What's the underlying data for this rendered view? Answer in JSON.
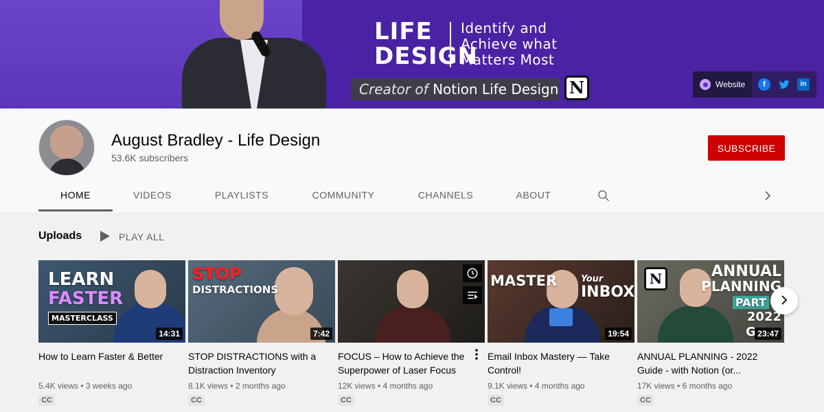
{
  "banner": {
    "title_line1": "LIFE",
    "title_line2": "DESIGN",
    "tagline_line1": "Identify and",
    "tagline_line2": "Achieve what",
    "tagline_line3": "Matters Most",
    "creator_prefix": "Creator",
    "creator_of": "of",
    "creator_suffix": "Notion Life Design",
    "notion_logo": "N",
    "links": {
      "website_label": "Website",
      "social_icons": [
        "facebook-icon",
        "twitter-icon",
        "linkedin-icon"
      ]
    }
  },
  "channel": {
    "name": "August Bradley - Life Design",
    "subscribers": "53.6K subscribers",
    "subscribe_label": "SUBSCRIBE"
  },
  "tabs": [
    {
      "label": "HOME",
      "active": true
    },
    {
      "label": "VIDEOS",
      "active": false
    },
    {
      "label": "PLAYLISTS",
      "active": false
    },
    {
      "label": "COMMUNITY",
      "active": false
    },
    {
      "label": "CHANNELS",
      "active": false
    },
    {
      "label": "ABOUT",
      "active": false
    }
  ],
  "uploads": {
    "title": "Uploads",
    "play_all_label": "PLAY ALL",
    "videos": [
      {
        "title": "How to Learn Faster & Better",
        "meta": "5.4K views • 3 weeks ago",
        "duration": "14:31",
        "cc": "CC",
        "thumb_text": [
          "LEARN",
          "FASTER",
          "MASTERCLASS"
        ]
      },
      {
        "title": "STOP DISTRACTIONS with a Distraction Inventory",
        "meta": "8.1K views • 2 months ago",
        "duration": "7:42",
        "cc": "CC",
        "thumb_text": [
          "STOP",
          "DISTRACTIONS"
        ]
      },
      {
        "title": "FOCUS – How to Achieve the Superpower of Laser Focus",
        "meta": "12K views • 4 months ago",
        "duration": "",
        "cc": "CC",
        "thumb_text": []
      },
      {
        "title": "Email Inbox Mastery — Take Control!",
        "meta": "9.1K views • 4 months ago",
        "duration": "19:54",
        "cc": "CC",
        "thumb_text": [
          "MASTER",
          "Your",
          "INBOX"
        ]
      },
      {
        "title": "ANNUAL PLANNING - 2022 Guide - with Notion (or...",
        "meta": "17K views • 6 months ago",
        "duration": "23:47",
        "cc": "CC",
        "thumb_text": [
          "ANNUAL",
          "PLANNING",
          "PART",
          "2022",
          "G"
        ]
      }
    ]
  },
  "colors": {
    "subscribe_red": "#cc0000",
    "banner_purple": "#4b24a6"
  }
}
